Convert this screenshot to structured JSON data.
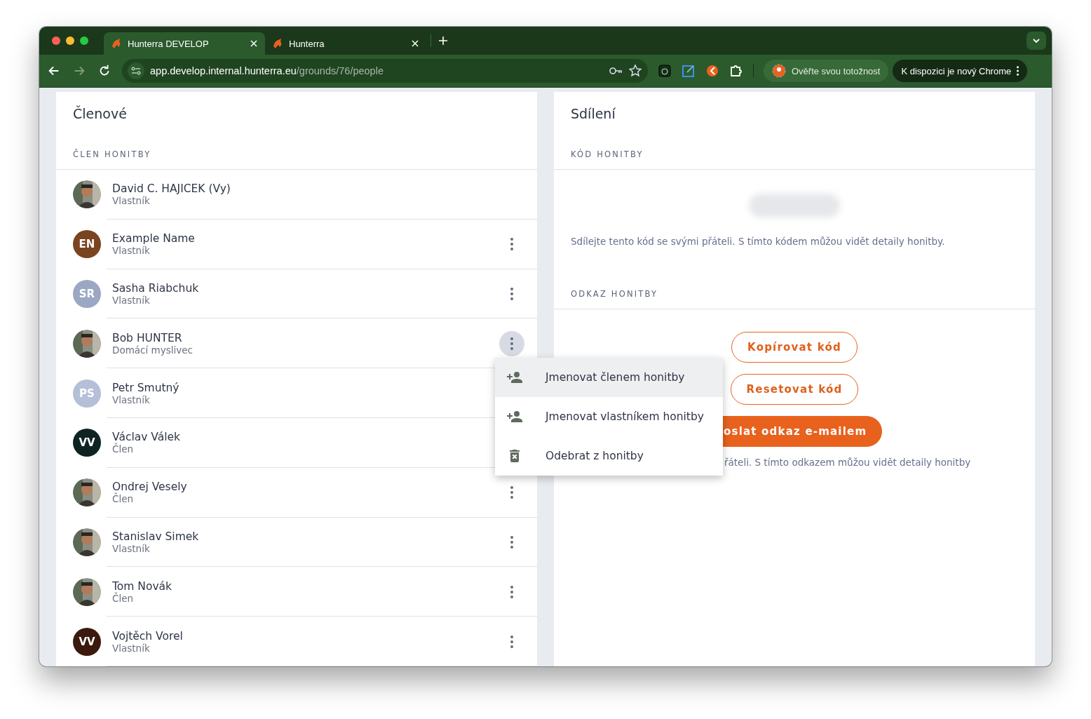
{
  "browser": {
    "tabs": [
      {
        "title": "Hunterra DEVELOP",
        "selected": true
      },
      {
        "title": "Hunterra",
        "selected": false
      }
    ],
    "url": {
      "host": "app.develop.internal.hunterra.eu",
      "path": "/grounds/76/people"
    },
    "forward_enabled": false,
    "profile_button": "Ověřte svou totožnost",
    "update_button": "K dispozici je nový Chrome"
  },
  "members": {
    "title": "Členové",
    "section": "ČLEN HONITBY",
    "items": [
      {
        "name": "David C. HAJICEK (Vy)",
        "role": "Vlastník",
        "menu_button": false,
        "active": false
      },
      {
        "name": "Example Name",
        "role": "Vlastník",
        "avatar": {
          "kind": "initials",
          "initials": "EN",
          "color": "#7a4420"
        },
        "menu_button": true,
        "active": false
      },
      {
        "name": "Sasha Riabchuk",
        "role": "Vlastník",
        "avatar": {
          "kind": "initials",
          "initials": "SR",
          "color": "#9ba8c3"
        },
        "menu_button": true,
        "active": false
      },
      {
        "name": "Bob HUNTER",
        "role": "Domácí myslivec",
        "menu_button": true,
        "active": true
      },
      {
        "name": "Petr Smutný",
        "role": "Vlastník",
        "avatar": {
          "kind": "initials",
          "initials": "PS",
          "color": "#b6bfd8"
        },
        "menu_button": false,
        "active": false
      },
      {
        "name": "Václav Válek",
        "role": "Člen",
        "avatar": {
          "kind": "initials",
          "initials": "VV",
          "color": "#0e2422"
        },
        "menu_button": false,
        "active": false
      },
      {
        "name": "Ondrej Vesely",
        "role": "Člen",
        "menu_button": true,
        "active": false
      },
      {
        "name": "Stanislav Simek",
        "role": "Vlastník",
        "menu_button": true,
        "active": false
      },
      {
        "name": "Tom Novák",
        "role": "Člen",
        "menu_button": true,
        "active": false
      },
      {
        "name": "Vojtěch Vorel",
        "role": "Vlastník",
        "avatar": {
          "kind": "initials",
          "initials": "VV",
          "color": "#3b190c"
        },
        "menu_button": true,
        "active": false
      }
    ]
  },
  "menu": {
    "items": [
      {
        "kind": "person-add",
        "label": "Jmenovat členem honitby",
        "selected": true
      },
      {
        "kind": "person-add",
        "label": "Jmenovat vlastníkem honitby",
        "selected": false
      },
      {
        "kind": "trash",
        "label": "Odebrat z honitby",
        "selected": false
      }
    ]
  },
  "sharing": {
    "title": "Sdílení",
    "code_section": "KÓD HONITBY",
    "code_hint": "Sdílejte tento kód se svými přáteli. S tímto kódem můžou vidět detaily honitby.",
    "link_section": "ODKAZ HONITBY",
    "buttons": [
      {
        "label": "Kopírovat kód",
        "kind": "outline"
      },
      {
        "label": "Resetovat kód",
        "kind": "outline"
      },
      {
        "label": "oslat odkaz e-mailem",
        "kind": "filled"
      }
    ],
    "link_hint": "řáteli. S tímto odkazem můžou vidět detaily honitby"
  }
}
